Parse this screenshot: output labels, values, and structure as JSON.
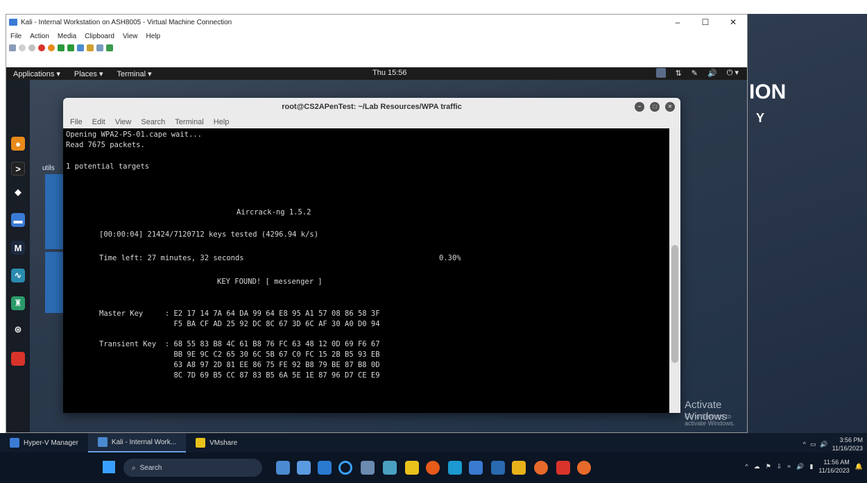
{
  "vm_window": {
    "title": "Kali - Internal Workstation on ASH8005 - Virtual Machine Connection",
    "controls": [
      "–",
      "☐",
      "✕"
    ],
    "menu": [
      "File",
      "Action",
      "Media",
      "Clipboard",
      "View",
      "Help"
    ]
  },
  "gnome_panel": {
    "applications": "Applications ▾",
    "places": "Places ▾",
    "terminal": "Terminal ▾",
    "clock": "Thu 15:56",
    "workspace": "1"
  },
  "terminal": {
    "title": "root@CS2APenTest: ~/Lab Resources/WPA traffic",
    "menu": [
      "File",
      "Edit",
      "View",
      "Search",
      "Terminal",
      "Help"
    ],
    "lines": {
      "l1": "Opening WPA2-PS-01.cape wait...",
      "l2": "Read 7675 packets.",
      "l3": "1 potential targets",
      "l4": "Aircrack-ng 1.5.2",
      "l5": "[00:00:04] 21424/7120712 keys tested (4296.94 k/s)",
      "l6": "Time left: 27 minutes, 32 seconds",
      "l6b": "0.30%",
      "l7": "KEY FOUND! [ messenger ]",
      "l8": "Master Key     : E2 17 14 7A 64 DA 99 64 E8 95 A1 57 08 86 58 3F",
      "l9": "                 F5 BA CF AD 25 92 DC 8C 67 3D 6C AF 30 A0 D0 94",
      "l10": "Transient Key  : 68 55 83 B8 4C 61 B8 76 FC 63 48 12 0D 69 F6 67",
      "l11": "                 BB 9E 9C C2 65 30 6C 5B 67 C0 FC 15 2B B5 93 EB",
      "l12": "                 63 A8 97 2D 81 EE 86 75 FE 92 B8 79 BE 87 B8 0D",
      "l13": "                 8C 7D 69 B5 CC 87 83 B5 6A 5E 1E 87 96 D7 CE E9"
    }
  },
  "desktop": {
    "ion_text": "ION",
    "y_text": "Y",
    "utils_text": "utils",
    "activate_title": "Activate Windows",
    "activate_sub": "Go to Settings to activate Windows."
  },
  "host_bar": {
    "items": [
      "Hyper-V Manager",
      "Kali - Internal Work...",
      "VMshare"
    ],
    "tray_time": "3:56 PM",
    "tray_date": "11/16/2023"
  },
  "windows_taskbar": {
    "search_placeholder": "Search",
    "time": "11:56 AM",
    "date": "11/16/2023"
  }
}
